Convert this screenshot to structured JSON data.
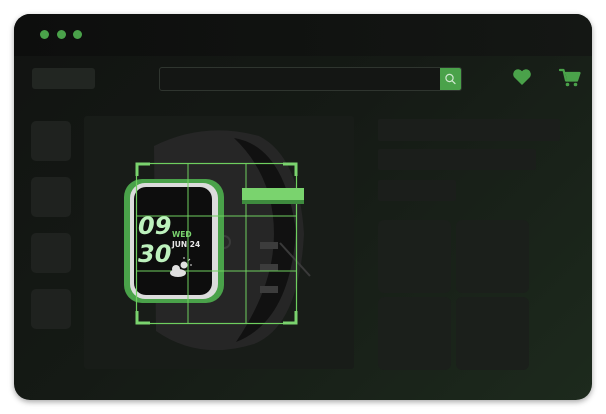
{
  "window": {
    "traffic_lights": [
      "#4aa24a",
      "#4aa24a",
      "#4aa24a"
    ]
  },
  "header": {
    "search": {
      "value": "",
      "placeholder": ""
    },
    "icons": [
      "search-icon",
      "heart-icon",
      "cart-icon"
    ]
  },
  "product": {
    "gallery": {
      "thumbnail_count": 4
    },
    "watch_face": {
      "hour": "09",
      "minute": "30",
      "weekday": "WED",
      "date": "JUN 24",
      "weather_icon": "weather-icon"
    },
    "variant_count": 4
  },
  "colors": {
    "accent": "#4aa24a",
    "accent_light": "#7ad36e",
    "background": "#121512",
    "placeholder": "#1c1f1c"
  }
}
